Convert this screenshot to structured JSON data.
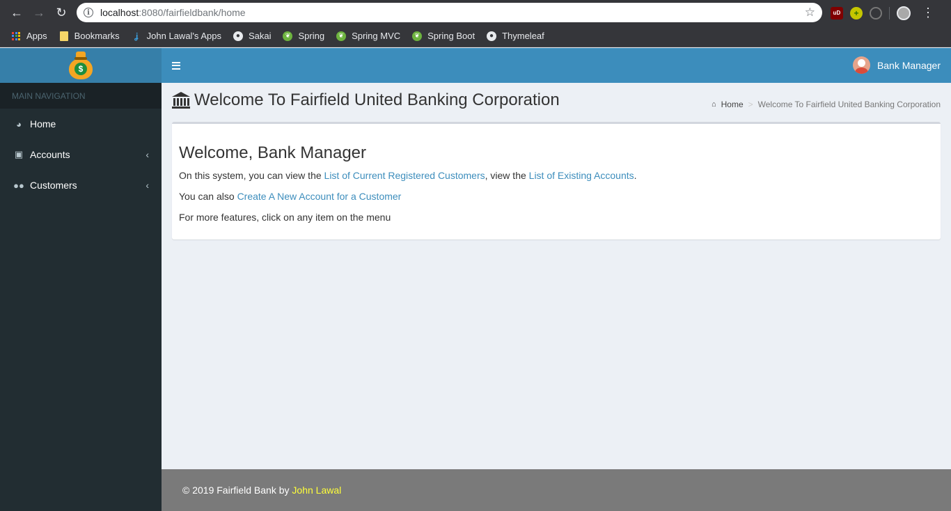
{
  "browser": {
    "url_host": "localhost",
    "url_path": ":8080/fairfieldbank/home",
    "bookmarks": [
      {
        "label": "Apps",
        "icon": "apps-grid-icon"
      },
      {
        "label": "Bookmarks",
        "icon": "folder-icon"
      },
      {
        "label": "John Lawal's Apps",
        "icon": "jl-logo-icon"
      },
      {
        "label": "Sakai",
        "icon": "globe-icon"
      },
      {
        "label": "Spring",
        "icon": "spring-leaf-icon"
      },
      {
        "label": "Spring MVC",
        "icon": "spring-leaf-icon"
      },
      {
        "label": "Spring Boot",
        "icon": "spring-leaf-icon"
      },
      {
        "label": "Thymeleaf",
        "icon": "globe-icon"
      }
    ],
    "extensions": {
      "ublock_label": "uD"
    }
  },
  "sidebar": {
    "nav_header": "MAIN NAVIGATION",
    "items": [
      {
        "label": "Home",
        "icon": "dashboard-icon"
      },
      {
        "label": "Accounts",
        "icon": "money-icon"
      },
      {
        "label": "Customers",
        "icon": "users-icon"
      }
    ]
  },
  "header": {
    "user_name": "Bank Manager"
  },
  "content": {
    "page_title": "Welcome To Fairfield United Banking Corporation",
    "breadcrumb": {
      "home": "Home",
      "current": "Welcome To Fairfield United Banking Corporation"
    },
    "welcome_heading": "Welcome, Bank Manager",
    "line1_prefix": "On this system, you can view the ",
    "line1_link1": "List of Current Registered Customers",
    "line1_middle": ", view the ",
    "line1_link2": "List of Existing Accounts",
    "line1_suffix": ".",
    "line2_prefix": "You can also ",
    "line2_link": "Create A New Account for a Customer",
    "line3": "For more features, click on any item on the menu"
  },
  "footer": {
    "prefix": "© 2019 Fairfield Bank by ",
    "author": "John Lawal"
  },
  "colors": {
    "sidebar_bg": "#222d32",
    "header_bg": "#3c8dbc",
    "logo_bg": "#367fa9",
    "link": "#3c8dbc",
    "footer_bg": "#7a7a7a",
    "footer_author": "#ffff3a",
    "content_bg": "#ecf0f5"
  }
}
